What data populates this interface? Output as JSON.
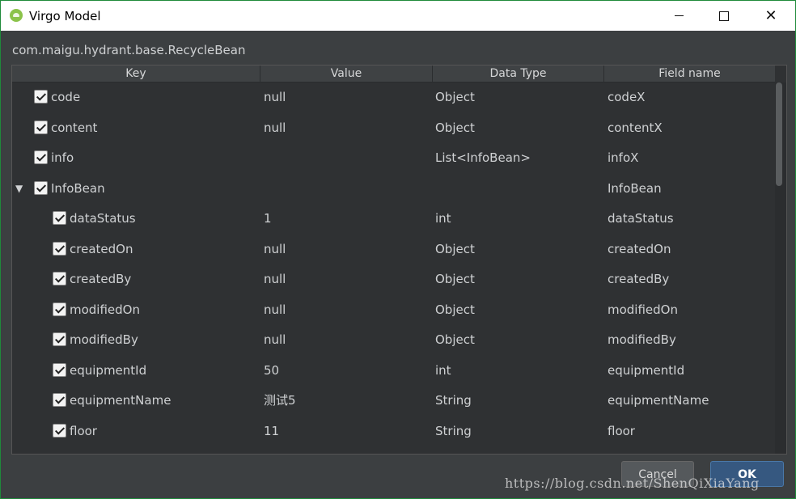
{
  "window": {
    "title": "Virgo Model",
    "icon": "android-icon"
  },
  "classname": "com.maigu.hydrant.base.RecycleBean",
  "table": {
    "headers": [
      "Key",
      "Value",
      "Data Type",
      "Field name"
    ],
    "rows": [
      {
        "key": "code",
        "value": "null",
        "type": "Object",
        "field": "codeX",
        "checked": true,
        "indent": 0
      },
      {
        "key": "content",
        "value": "null",
        "type": "Object",
        "field": "contentX",
        "checked": true,
        "indent": 0
      },
      {
        "key": "info",
        "value": "",
        "type": "List<InfoBean>",
        "field": "infoX",
        "checked": true,
        "indent": 0
      },
      {
        "key": "InfoBean",
        "value": "",
        "type": "",
        "field": "InfoBean",
        "checked": true,
        "indent": 0,
        "expanded": true
      },
      {
        "key": "dataStatus",
        "value": "1",
        "type": "int",
        "field": "dataStatus",
        "checked": true,
        "indent": 1
      },
      {
        "key": "createdOn",
        "value": "null",
        "type": "Object",
        "field": "createdOn",
        "checked": true,
        "indent": 1
      },
      {
        "key": "createdBy",
        "value": "null",
        "type": "Object",
        "field": "createdBy",
        "checked": true,
        "indent": 1
      },
      {
        "key": "modifiedOn",
        "value": "null",
        "type": "Object",
        "field": "modifiedOn",
        "checked": true,
        "indent": 1
      },
      {
        "key": "modifiedBy",
        "value": "null",
        "type": "Object",
        "field": "modifiedBy",
        "checked": true,
        "indent": 1
      },
      {
        "key": "equipmentId",
        "value": "50",
        "type": "int",
        "field": "equipmentId",
        "checked": true,
        "indent": 1
      },
      {
        "key": "equipmentName",
        "value": "测试5",
        "type": "String",
        "field": "equipmentName",
        "checked": true,
        "indent": 1
      },
      {
        "key": "floor",
        "value": "11",
        "type": "String",
        "field": "floor",
        "checked": true,
        "indent": 1
      }
    ]
  },
  "buttons": {
    "cancel": "Cancel",
    "ok": "OK"
  },
  "watermark": "https://blog.csdn.net/ShenQiXiaYang"
}
